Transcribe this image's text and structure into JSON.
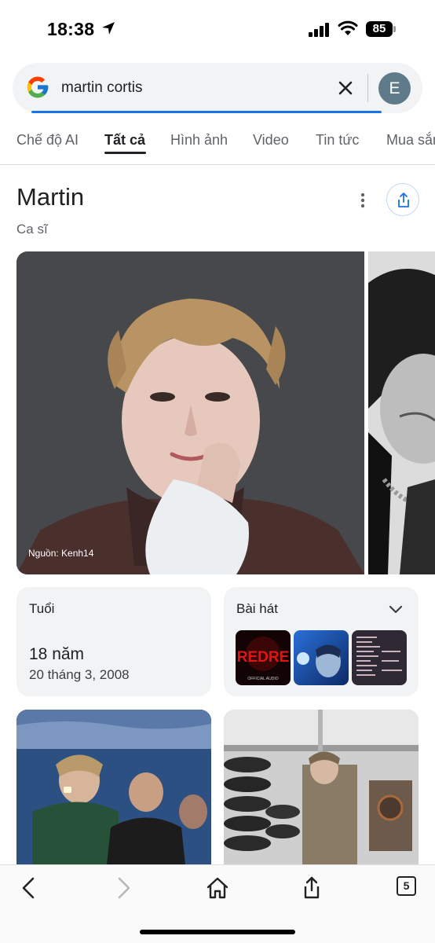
{
  "status_bar": {
    "time": "18:38",
    "battery": "85"
  },
  "search": {
    "query": "martin cortis",
    "account_initial": "E"
  },
  "tabs": [
    {
      "label": "Chế độ AI",
      "active": false
    },
    {
      "label": "Tất cả",
      "active": true
    },
    {
      "label": "Hình ảnh",
      "active": false
    },
    {
      "label": "Video",
      "active": false
    },
    {
      "label": "Tin tức",
      "active": false
    },
    {
      "label": "Mua sắm",
      "active": false
    }
  ],
  "entity": {
    "title": "Martin",
    "subtitle": "Ca sĩ",
    "photo_credit": "Nguồn: Kenh14"
  },
  "cards": {
    "age": {
      "label": "Tuổi",
      "value": "18 năm",
      "birth_date": "20 tháng 3, 2008"
    },
    "songs": {
      "label": "Bài hát",
      "thumb1_text": "REDRE",
      "thumb1_sub": "OFFICIAL AUDIO"
    }
  },
  "toolbar": {
    "tab_count": "5"
  },
  "colors": {
    "accent": "#1a73e8",
    "card_bg": "#f1f3f4",
    "avatar": "#5f7b89"
  }
}
